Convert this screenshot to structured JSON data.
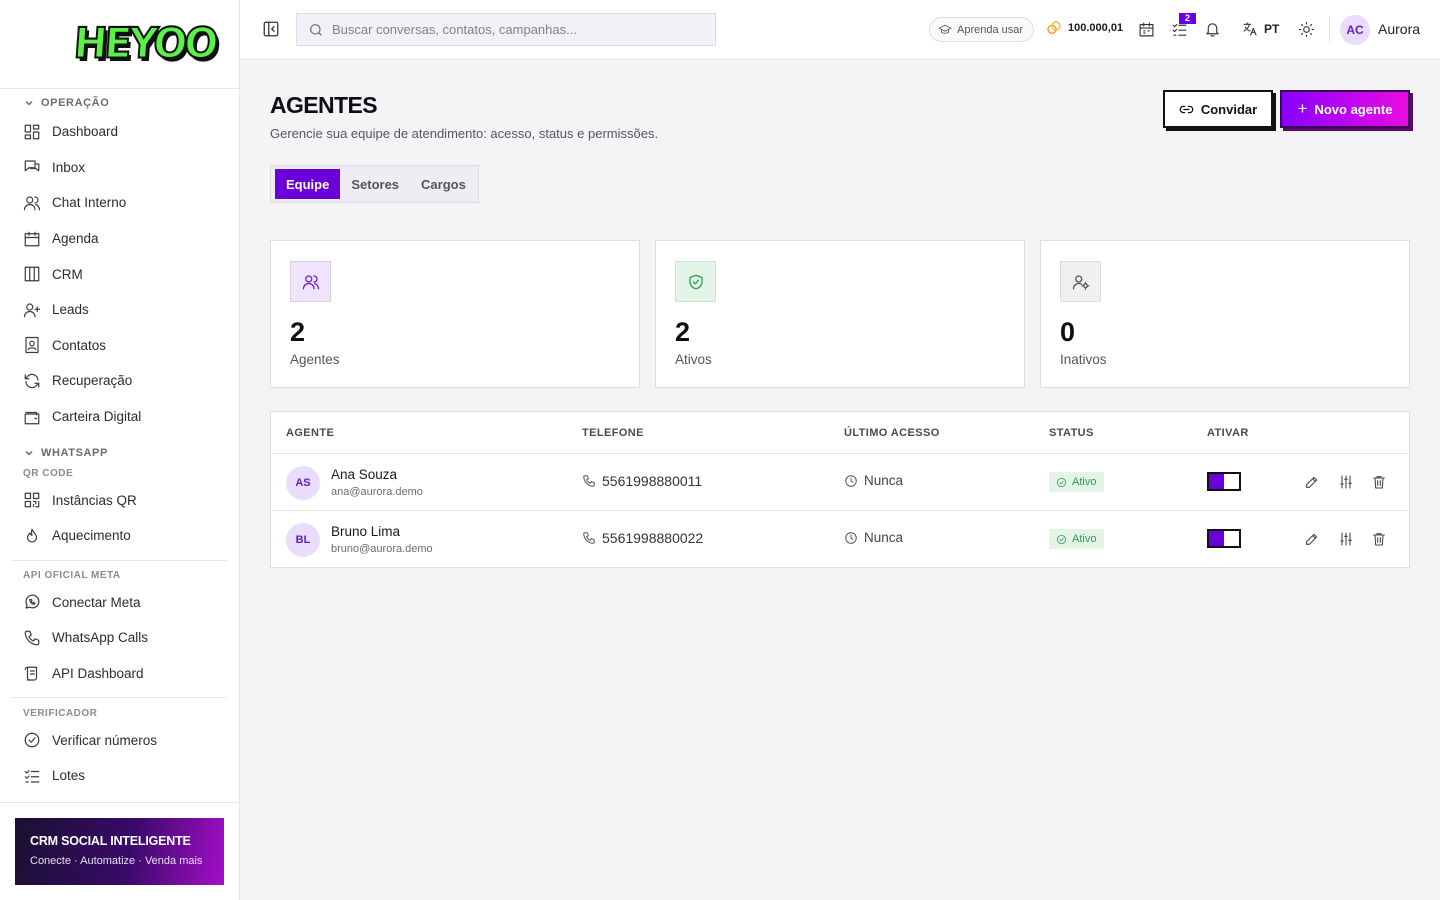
{
  "brand": {
    "logo_text": "HEYOO"
  },
  "sidebar": {
    "sections": [
      {
        "title": "OPERAÇÃO",
        "items": [
          "Dashboard",
          "Inbox",
          "Chat Interno",
          "Agenda",
          "CRM",
          "Leads",
          "Contatos",
          "Recuperação",
          "Carteira Digital"
        ]
      },
      {
        "title": "WHATSAPP",
        "sub": "QR CODE",
        "items": [
          "Instâncias QR",
          "Aquecimento"
        ]
      },
      {
        "sub": "API OFICIAL META",
        "items": [
          "Conectar Meta",
          "WhatsApp Calls",
          "API Dashboard"
        ]
      },
      {
        "sub": "VERIFICADOR",
        "items": [
          "Verificar números",
          "Lotes"
        ]
      }
    ],
    "promo": {
      "title": "CRM SOCIAL INTELIGENTE",
      "subtitle": "Conecte · Automatize · Venda mais"
    }
  },
  "topbar": {
    "search_placeholder": "Buscar conversas, contatos, campanhas...",
    "learn_label": "Aprenda usar",
    "credits": "100.000,01",
    "tasks_badge": "2",
    "language": "PT",
    "user": {
      "initials": "AC",
      "name": "Aurora"
    }
  },
  "page": {
    "title": "AGENTES",
    "subtitle": "Gerencie sua equipe de atendimento: acesso, status e permissões.",
    "invite_label": "Convidar",
    "new_agent_label": "Novo agente",
    "tabs": [
      "Equipe",
      "Setores",
      "Cargos"
    ]
  },
  "stats": [
    {
      "value": "2",
      "label": "Agentes",
      "icon": "users-icon"
    },
    {
      "value": "2",
      "label": "Ativos",
      "icon": "shield-check-icon"
    },
    {
      "value": "0",
      "label": "Inativos",
      "icon": "user-gear-icon"
    }
  ],
  "table": {
    "headers": [
      "AGENTE",
      "TELEFONE",
      "ÚLTIMO ACESSO",
      "STATUS",
      "ATIVAR"
    ],
    "rows": [
      {
        "initials": "AS",
        "name": "Ana Souza",
        "email": "ana@aurora.demo",
        "phone": "5561998880011",
        "last_access": "Nunca",
        "status": "Ativo",
        "active": true
      },
      {
        "initials": "BL",
        "name": "Bruno Lima",
        "email": "bruno@aurora.demo",
        "phone": "5561998880022",
        "last_access": "Nunca",
        "status": "Ativo",
        "active": true
      }
    ]
  },
  "colors": {
    "accent": "#6a00d8",
    "brand_green": "#5cf04a",
    "success": "#2f9a4f"
  }
}
